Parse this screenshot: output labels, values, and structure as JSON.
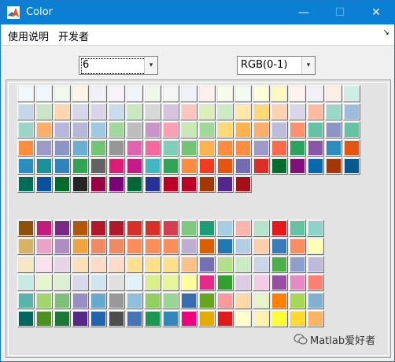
{
  "window": {
    "title": "Color",
    "minimize": "—",
    "maximize": "☐",
    "close": "✕"
  },
  "menu": {
    "items": [
      "使用说明",
      "开发者"
    ],
    "corner_arrow": "↘"
  },
  "controls": {
    "count_select": {
      "value": "6",
      "arrow": "▾"
    },
    "mode_select": {
      "value": "RGB(0-1)",
      "arrow": "▾"
    }
  },
  "palette_top": {
    "cols": 19,
    "colors": [
      "#f0f8fc",
      "#eff6fc",
      "#eff9ec",
      "#fff4e8",
      "#f2f1f8",
      "#f8f2fb",
      "#f0f5fc",
      "#edf8ea",
      "#f5f5f5",
      "#f0f1fb",
      "#fdf0ef",
      "#f7fcea",
      "#f3fbf0",
      "#fffed8",
      "#fff8c0",
      "#fef4ec",
      "#f3f0f7",
      "#fdeee6",
      "#cceee4",
      "#c5d6ea",
      "#c9e5c5",
      "#fed6b0",
      "#d8d6ea",
      "#d9d3ec",
      "#c8dcee",
      "#c8e9c0",
      "#d8d8d8",
      "#d8c2e1",
      "#fcc5c0",
      "#dcefba",
      "#cde9c5",
      "#ffe8a8",
      "#fed976",
      "#fdd2ae",
      "#d9d6ea",
      "#fcbba1",
      "#99d8c8",
      "#9fbcdc",
      "#9bd4c8",
      "#fdae6b",
      "#b9b8dc",
      "#b6b7da",
      "#9ecae1",
      "#a1d99b",
      "#bdbdbd",
      "#c994c7",
      "#fa9fb5",
      "#c7e9b4",
      "#a1d99b",
      "#fed976",
      "#feb24c",
      "#fdae6b",
      "#bcbddc",
      "#fc9272",
      "#66c2a4",
      "#8c96c6",
      "#66c2a4",
      "#fd8d3c",
      "#9e9ac8",
      "#8c96c6",
      "#6baed6",
      "#74c476",
      "#969696",
      "#df65b0",
      "#f768a1",
      "#7fcdbb",
      "#74c476",
      "#feb24c",
      "#fd8d3c",
      "#fd8d3c",
      "#9e9ac8",
      "#fb6a4a",
      "#2ca25f",
      "#8856a7",
      "#2b8cbe",
      "#e6550d",
      "#2b8cbe",
      "#1c9099",
      "#3182bd",
      "#31a354",
      "#636363",
      "#dd1c77",
      "#c51b8a",
      "#41b6c4",
      "#31a354",
      "#fd8d3c",
      "#f03b20",
      "#e6550d",
      "#756bb1",
      "#de2d26",
      "#006d2c",
      "#810f7c",
      "#0868ac",
      "#a63603",
      "#045a8d",
      "#016c59",
      "#08519c",
      "#006d2c",
      "#252525",
      "#980043",
      "#7a0177",
      "#006837",
      "#253494",
      "#bd0026",
      "#bd0026",
      "#a63603",
      "#54278f",
      "#a50f15"
    ]
  },
  "palette_bottom": {
    "cols": 17,
    "colors": [
      "#8c510a",
      "#c51b7d",
      "#762a83",
      "#b35806",
      "#b2182b",
      "#b2182b",
      "#d73027",
      "#d73027",
      "#d53e4f",
      "#7fc97f",
      "#1b9e77",
      "#a6cee3",
      "#fbb4ae",
      "#b3e2cd",
      "#e41a1c",
      "#66c2a5",
      "#8dd3c7",
      "#d8b365",
      "#e9a3c9",
      "#af8dc3",
      "#f1a340",
      "#ef8a62",
      "#ef8a62",
      "#fc8d59",
      "#fc8d59",
      "#fc8d59",
      "#beaed4",
      "#d95f02",
      "#1f78b4",
      "#b3cde3",
      "#fdcdac",
      "#377eb8",
      "#fc8d62",
      "#ffffb3",
      "#f6e8c3",
      "#fde0ef",
      "#e7d4e8",
      "#fee0b6",
      "#fddbc7",
      "#fddbc7",
      "#fee090",
      "#fee08b",
      "#fee08b",
      "#fdc086",
      "#7570b3",
      "#b2df8a",
      "#ccebc5",
      "#cbd5e8",
      "#4daf4a",
      "#8da0cb",
      "#bebada",
      "#c7eae5",
      "#e6f5d0",
      "#d9f0d3",
      "#d8daeb",
      "#d1e5f0",
      "#e0e0e0",
      "#e0f3f8",
      "#d9ef8b",
      "#e6f598",
      "#ffff99",
      "#e7298a",
      "#33a02c",
      "#decbe4",
      "#f4cae4",
      "#984ea3",
      "#e78ac3",
      "#fb8072",
      "#5ab4ac",
      "#a1d76a",
      "#7fbf7b",
      "#998ec3",
      "#67a9cf",
      "#999999",
      "#91bfdb",
      "#91cf60",
      "#99d594",
      "#386cb0",
      "#66a61e",
      "#fb9a99",
      "#fed9a6",
      "#e6f5c9",
      "#ff7f00",
      "#a6d854",
      "#80b1d3",
      "#01665e",
      "#4d9221",
      "#1b7837",
      "#542788",
      "#2166ac",
      "#4d4d4d",
      "#4575b4",
      "#1a9850",
      "#3288bd",
      "#f0027f",
      "#e6ab02",
      "#e31a1c",
      "#ffffcc",
      "#fff2ae",
      "#ffff33",
      "#ffd92f",
      "#fdb462"
    ]
  },
  "watermark": {
    "text": "Matlab爱好者"
  }
}
